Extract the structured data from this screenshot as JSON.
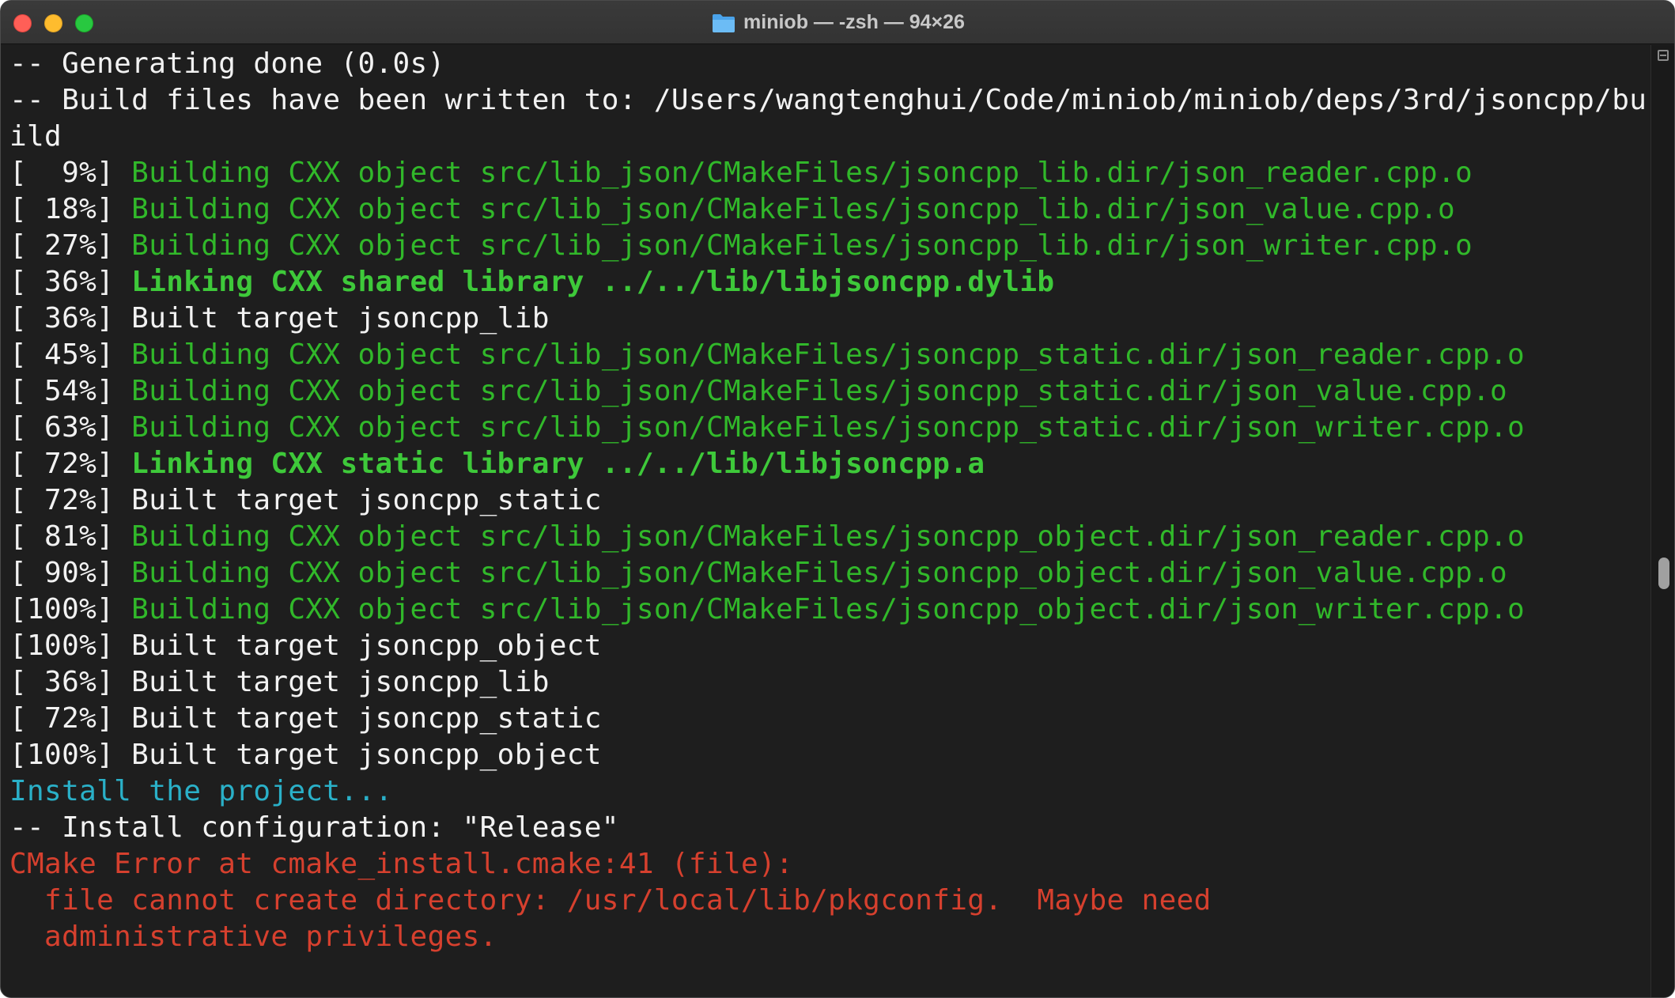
{
  "window": {
    "title": "miniob — -zsh — 94×26",
    "folder_icon": "folder-icon"
  },
  "terminal": {
    "lines": [
      {
        "prefix": "",
        "text": "-- Generating done (0.0s)",
        "style": "white"
      },
      {
        "prefix": "",
        "text": "-- Build files have been written to: /Users/wangtenghui/Code/miniob/miniob/deps/3rd/jsoncpp/bu",
        "style": "white"
      },
      {
        "prefix": "",
        "text": "ild",
        "style": "white"
      },
      {
        "prefix": "[  9%] ",
        "text": "Building CXX object src/lib_json/CMakeFiles/jsoncpp_lib.dir/json_reader.cpp.o",
        "style": "green"
      },
      {
        "prefix": "[ 18%] ",
        "text": "Building CXX object src/lib_json/CMakeFiles/jsoncpp_lib.dir/json_value.cpp.o",
        "style": "green"
      },
      {
        "prefix": "[ 27%] ",
        "text": "Building CXX object src/lib_json/CMakeFiles/jsoncpp_lib.dir/json_writer.cpp.o",
        "style": "green"
      },
      {
        "prefix": "[ 36%] ",
        "text": "Linking CXX shared library ../../lib/libjsoncpp.dylib",
        "style": "green-bold"
      },
      {
        "prefix": "[ 36%] ",
        "text": "Built target jsoncpp_lib",
        "style": "white"
      },
      {
        "prefix": "[ 45%] ",
        "text": "Building CXX object src/lib_json/CMakeFiles/jsoncpp_static.dir/json_reader.cpp.o",
        "style": "green"
      },
      {
        "prefix": "[ 54%] ",
        "text": "Building CXX object src/lib_json/CMakeFiles/jsoncpp_static.dir/json_value.cpp.o",
        "style": "green"
      },
      {
        "prefix": "[ 63%] ",
        "text": "Building CXX object src/lib_json/CMakeFiles/jsoncpp_static.dir/json_writer.cpp.o",
        "style": "green"
      },
      {
        "prefix": "[ 72%] ",
        "text": "Linking CXX static library ../../lib/libjsoncpp.a",
        "style": "green-bold"
      },
      {
        "prefix": "[ 72%] ",
        "text": "Built target jsoncpp_static",
        "style": "white"
      },
      {
        "prefix": "[ 81%] ",
        "text": "Building CXX object src/lib_json/CMakeFiles/jsoncpp_object.dir/json_reader.cpp.o",
        "style": "green"
      },
      {
        "prefix": "[ 90%] ",
        "text": "Building CXX object src/lib_json/CMakeFiles/jsoncpp_object.dir/json_value.cpp.o",
        "style": "green"
      },
      {
        "prefix": "[100%] ",
        "text": "Building CXX object src/lib_json/CMakeFiles/jsoncpp_object.dir/json_writer.cpp.o",
        "style": "green"
      },
      {
        "prefix": "[100%] ",
        "text": "Built target jsoncpp_object",
        "style": "white"
      },
      {
        "prefix": "[ 36%] ",
        "text": "Built target jsoncpp_lib",
        "style": "white"
      },
      {
        "prefix": "[ 72%] ",
        "text": "Built target jsoncpp_static",
        "style": "white"
      },
      {
        "prefix": "[100%] ",
        "text": "Built target jsoncpp_object",
        "style": "white"
      },
      {
        "prefix": "",
        "text": "Install the project...",
        "style": "cyan"
      },
      {
        "prefix": "",
        "text": "-- Install configuration: \"Release\"",
        "style": "white"
      },
      {
        "prefix": "",
        "text": "CMake Error at cmake_install.cmake:41 (file):",
        "style": "red"
      },
      {
        "prefix": "",
        "text": "  file cannot create directory: /usr/local/lib/pkgconfig.  Maybe need",
        "style": "red"
      },
      {
        "prefix": "",
        "text": "  administrative privileges.",
        "style": "red"
      }
    ]
  },
  "colors": {
    "background": "#1e1e1e",
    "text": "#f2f2f2",
    "green": "#31b82a",
    "cyan": "#2ab0c8",
    "red": "#d6402e"
  },
  "scrollbar": {
    "top_icon": "scroll-to-top-icon"
  }
}
